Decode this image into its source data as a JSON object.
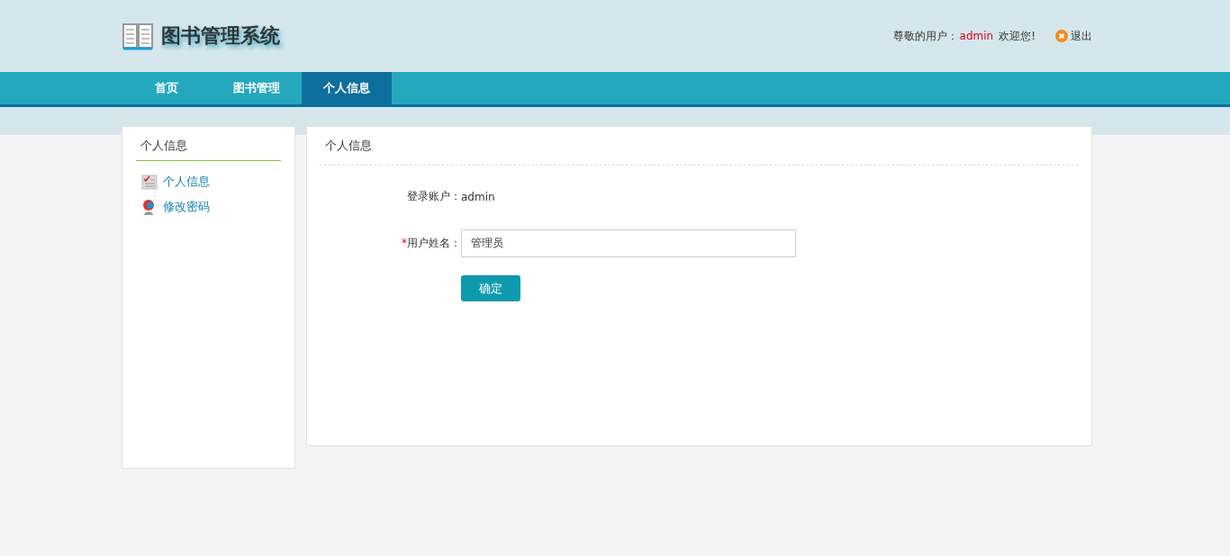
{
  "header": {
    "title": "图书管理系统",
    "greeting": "尊敬的用户：",
    "username": "admin",
    "welcome": "欢迎您!",
    "logout": "退出"
  },
  "nav": [
    {
      "label": "首页",
      "selected": false
    },
    {
      "label": "图书管理",
      "selected": false
    },
    {
      "label": "个人信息",
      "selected": true
    }
  ],
  "sidebar": {
    "title": "个人信息",
    "items": [
      {
        "label": "个人信息",
        "kind": "profile"
      },
      {
        "label": "修改密码",
        "kind": "password"
      }
    ]
  },
  "panel": {
    "title": "个人信息",
    "account_label": "登录账户：",
    "account_value": "admin",
    "name_required_mark": "*",
    "name_label": "用户姓名：",
    "name_value": "管理员",
    "submit": "确定"
  }
}
